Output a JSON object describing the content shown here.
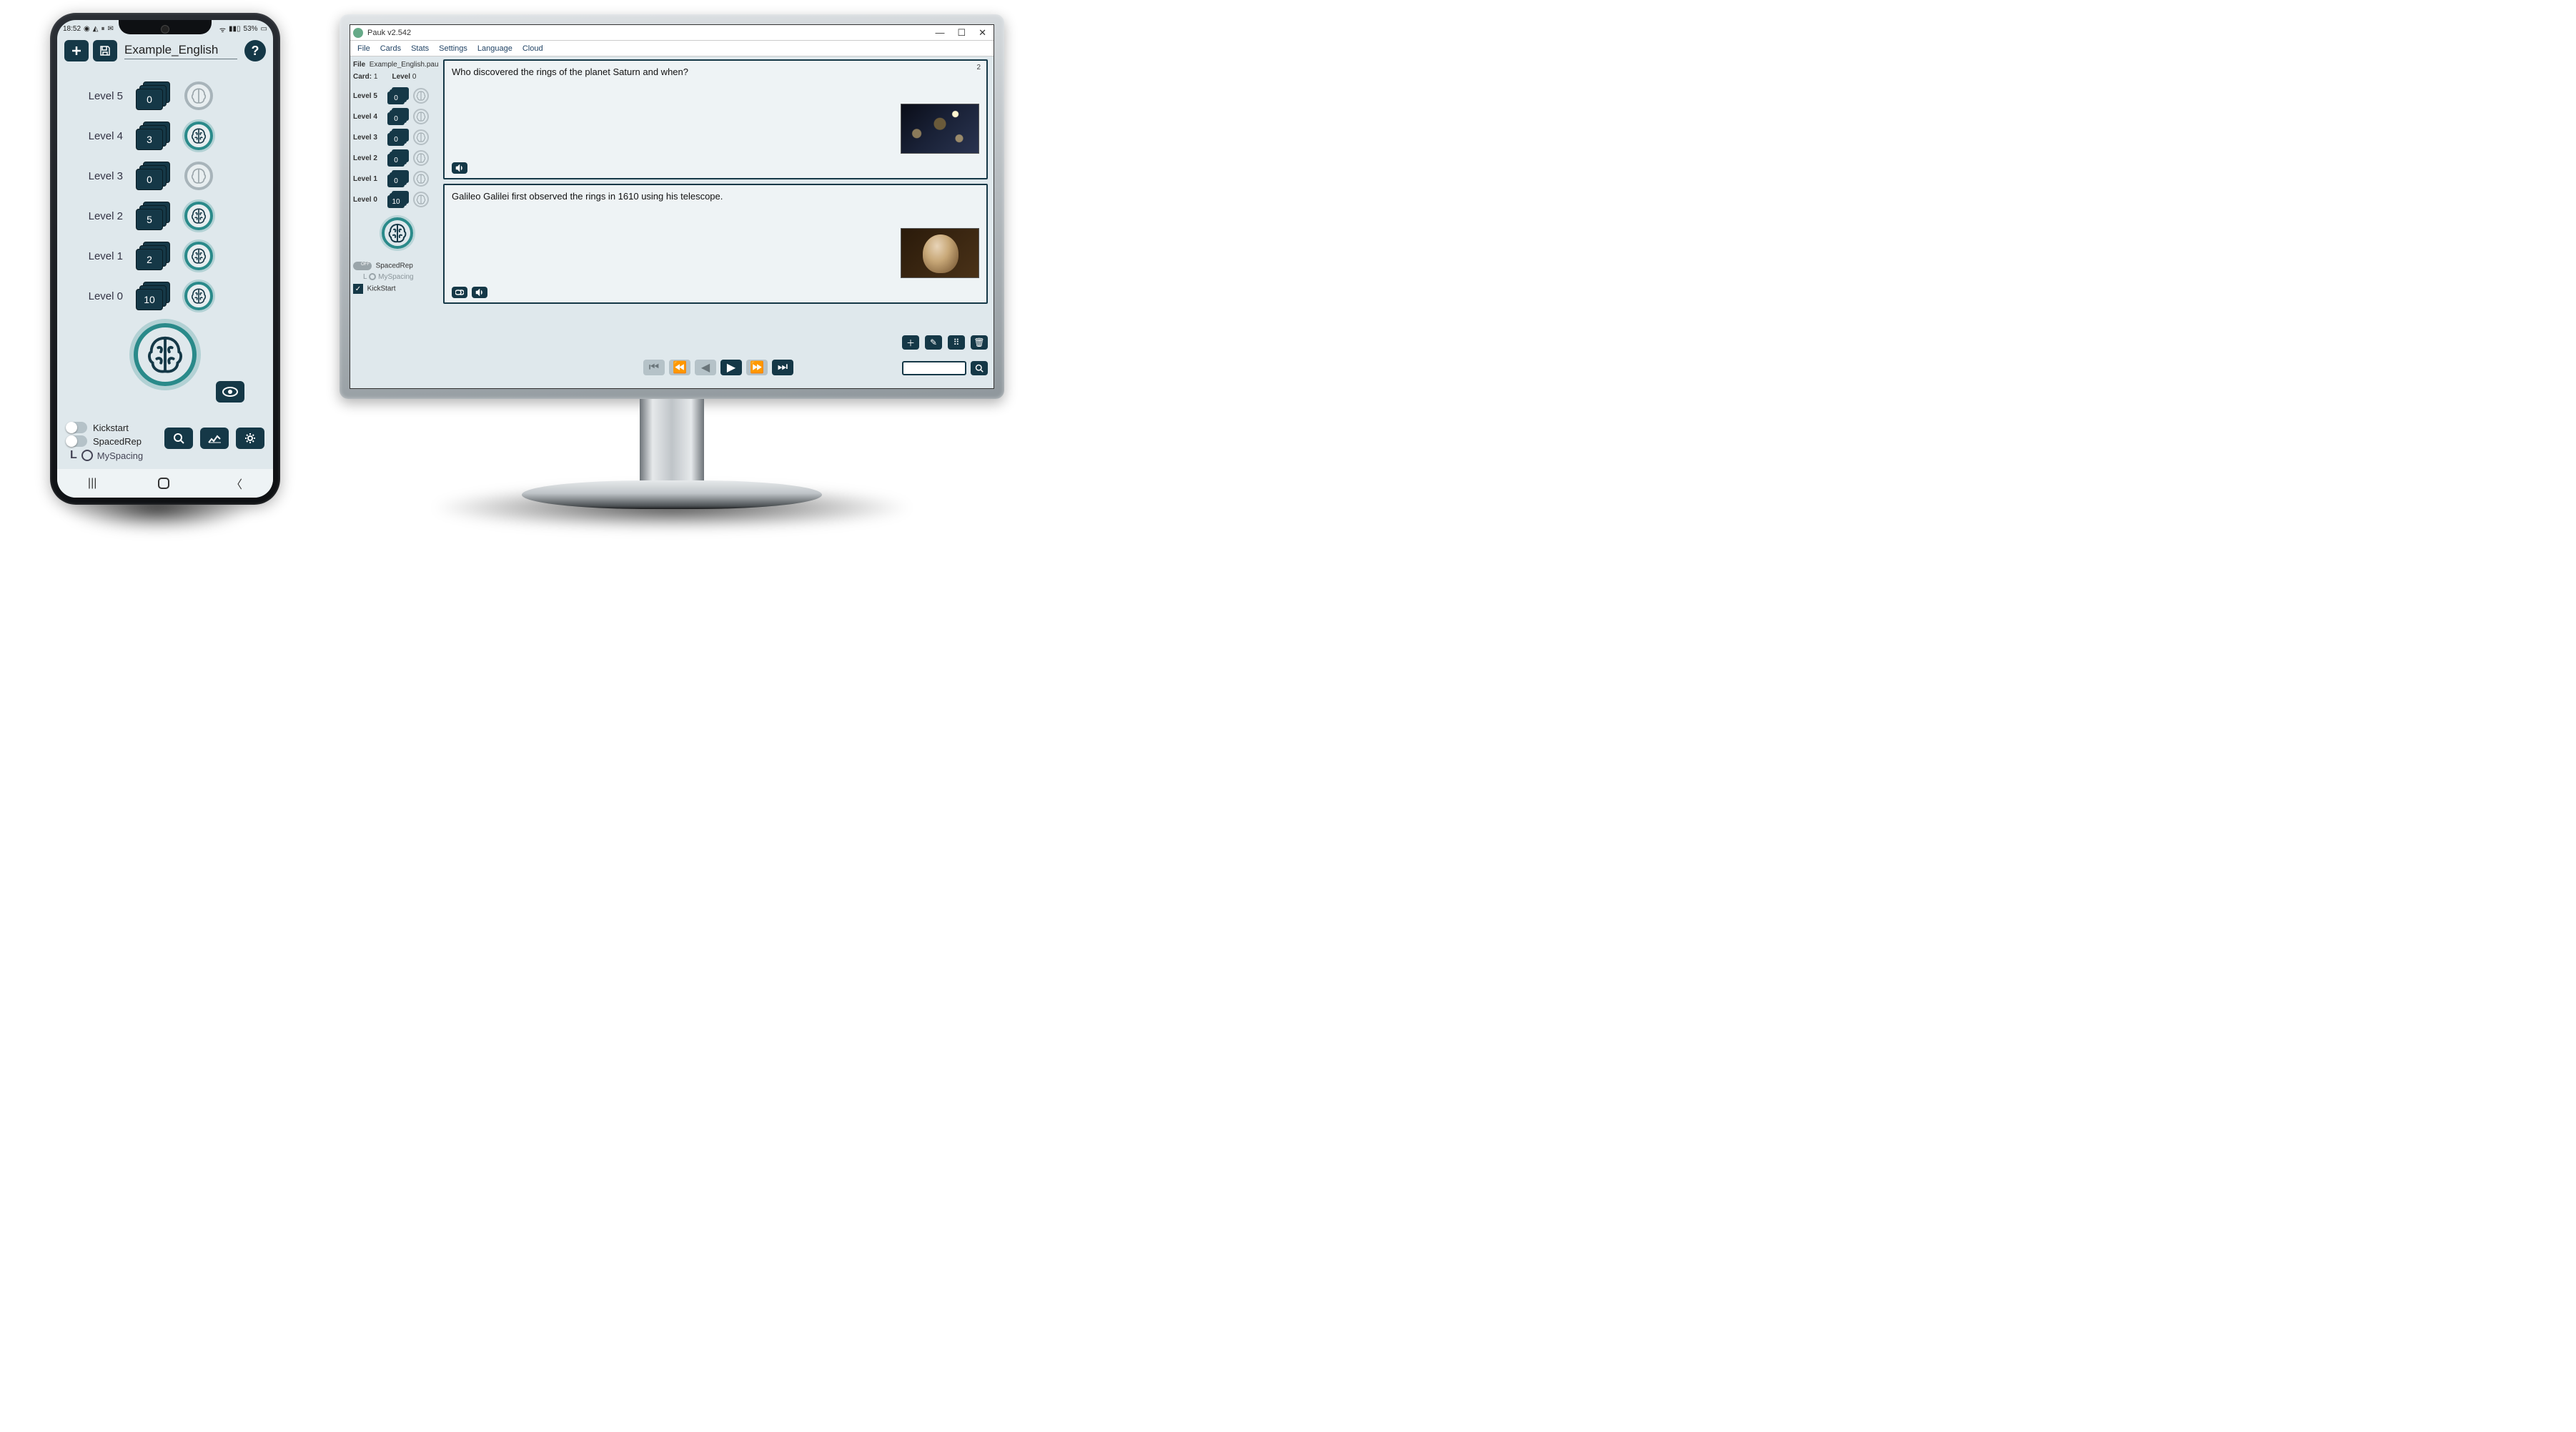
{
  "mobile": {
    "status_time": "18:52",
    "battery": "53%",
    "title": "Example_English",
    "levels": [
      {
        "label": "Level 5",
        "count": "0",
        "active": false
      },
      {
        "label": "Level 4",
        "count": "3",
        "active": true
      },
      {
        "label": "Level 3",
        "count": "0",
        "active": false
      },
      {
        "label": "Level 2",
        "count": "5",
        "active": true
      },
      {
        "label": "Level 1",
        "count": "2",
        "active": true
      },
      {
        "label": "Level 0",
        "count": "10",
        "active": true
      }
    ],
    "kickstart": "Kickstart",
    "spacedrep": "SpacedRep",
    "myspacing": "MySpacing"
  },
  "desktop": {
    "window_title": "Pauk  v2.542",
    "menu": [
      "File",
      "Cards",
      "Stats",
      "Settings",
      "Language",
      "Cloud"
    ],
    "file_label": "File",
    "file_name": "Example_English.pau",
    "card_label": "Card:",
    "card_num": "1",
    "level_label": "Level",
    "level_num": "0",
    "levels": [
      {
        "label": "Level 5",
        "count": "0"
      },
      {
        "label": "Level 4",
        "count": "0"
      },
      {
        "label": "Level 3",
        "count": "0"
      },
      {
        "label": "Level 2",
        "count": "0"
      },
      {
        "label": "Level 1",
        "count": "0"
      },
      {
        "label": "Level 0",
        "count": "10"
      }
    ],
    "spacedrep": "SpacedRep",
    "myspacing": "MySpacing",
    "kickstart": "KickStart",
    "question_num": "2",
    "question": "Who discovered the rings of the planet Saturn and when?",
    "answer": "Galileo Galilei first observed the rings in 1610 using his telescope.",
    "search_placeholder": ""
  }
}
